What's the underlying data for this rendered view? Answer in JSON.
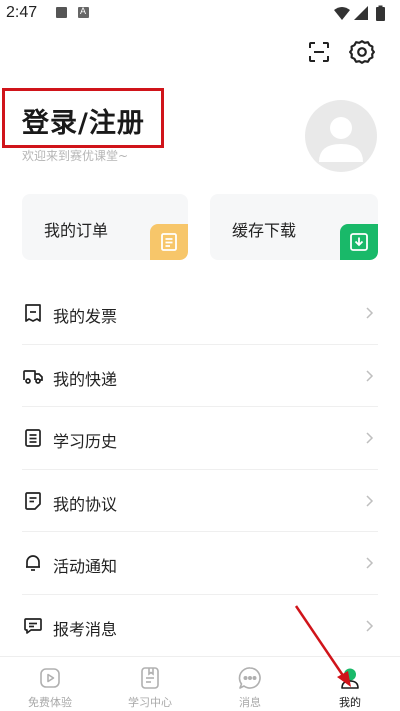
{
  "status_bar": {
    "time": "2:47"
  },
  "header": {
    "scan_icon": "scan-icon",
    "settings_icon": "gear-icon"
  },
  "profile": {
    "login_label": "登录/注册",
    "welcome_text": "欢迎来到赛优课堂~",
    "avatar_icon": "user-avatar-icon"
  },
  "cards": [
    {
      "label": "我的订单",
      "icon": "receipt-icon",
      "color": "#f7c66a"
    },
    {
      "label": "缓存下载",
      "icon": "download-icon",
      "color": "#19b969"
    }
  ],
  "menu": [
    {
      "label": "我的发票",
      "icon": "invoice-icon"
    },
    {
      "label": "我的快递",
      "icon": "truck-icon"
    },
    {
      "label": "学习历史",
      "icon": "history-icon"
    },
    {
      "label": "我的协议",
      "icon": "agreement-icon"
    },
    {
      "label": "活动通知",
      "icon": "bell-icon"
    },
    {
      "label": "报考消息",
      "icon": "message-icon"
    }
  ],
  "bottom_nav": [
    {
      "label": "免费体验",
      "icon": "play-icon",
      "active": false
    },
    {
      "label": "学习中心",
      "icon": "study-icon",
      "active": false
    },
    {
      "label": "消息",
      "icon": "chat-icon",
      "active": false
    },
    {
      "label": "我的",
      "icon": "profile-icon",
      "active": true
    }
  ],
  "colors": {
    "accent_green": "#19b969",
    "accent_yellow": "#f7c66a",
    "highlight_red": "#d0141a"
  }
}
